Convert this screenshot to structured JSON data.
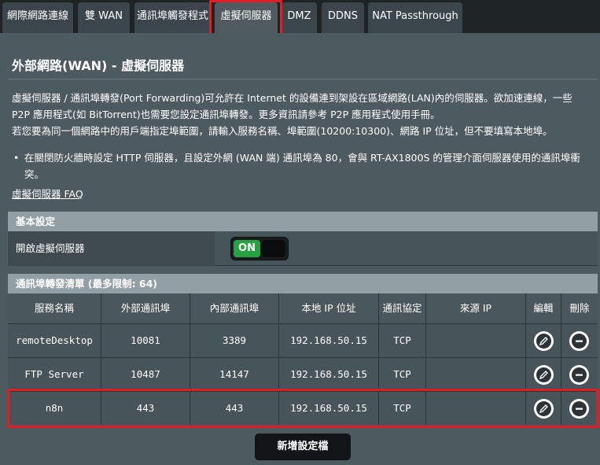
{
  "tabs": [
    {
      "label": "網際網路連線",
      "active": false
    },
    {
      "label": "雙 WAN",
      "active": false
    },
    {
      "label": "通訊埠觸發程式",
      "active": false
    },
    {
      "label": "虛擬伺服器",
      "active": true
    },
    {
      "label": "DMZ",
      "active": false
    },
    {
      "label": "DDNS",
      "active": false
    },
    {
      "label": "NAT Passthrough",
      "active": false
    }
  ],
  "page": {
    "title": "外部網路(WAN) - 虛擬伺服器",
    "desc_lines": [
      "虛擬伺服器 / 通訊埠轉發(Port Forwarding)可允許在 Internet 的設備連到架設在區域網路(LAN)內的伺服器。欲加速連線，一些",
      "P2P 應用程式(如 BitTorrent)也需要您設定通訊埠轉發。更多資訊請參考 P2P 應用程式使用手冊。",
      "若您要為同一個網路中的用戶端指定埠範圍，請輸入服務名稱、埠範圍(10200:10300)、網路 IP 位址，但不要填寫本地埠。"
    ],
    "bullet": "在關閉防火牆時設定 HTTP 伺服器，且設定外網 (WAN 端) 通訊埠為 80，會與 RT-AX1800S 的管理介面伺服器使用的通訊埠衝突。",
    "faq_link": "虛擬伺服器 FAQ"
  },
  "basic": {
    "header": "基本設定",
    "enable_label": "開啟虛擬伺服器",
    "toggle_state": "ON"
  },
  "list": {
    "header": "通訊埠轉發清單 (最多限制: 64)",
    "columns": [
      "服務名稱",
      "外部通訊埠",
      "內部通訊埠",
      "本地 IP 位址",
      "通訊協定",
      "來源 IP",
      "編輯",
      "刪除"
    ],
    "rows": [
      {
        "service": "remoteDesktop",
        "ext_port": "10081",
        "int_port": "3389",
        "ip": "192.168.50.15",
        "protocol": "TCP",
        "source_ip": ""
      },
      {
        "service": "FTP Server",
        "ext_port": "10487",
        "int_port": "14147",
        "ip": "192.168.50.15",
        "protocol": "TCP",
        "source_ip": ""
      },
      {
        "service": "n8n",
        "ext_port": "443",
        "int_port": "443",
        "ip": "192.168.50.15",
        "protocol": "TCP",
        "source_ip": ""
      }
    ],
    "add_button": "新增設定檔"
  },
  "colors": {
    "accent_green": "#27a144",
    "highlight_red": "#e21d24",
    "panel_bg": "#4d5a60"
  }
}
